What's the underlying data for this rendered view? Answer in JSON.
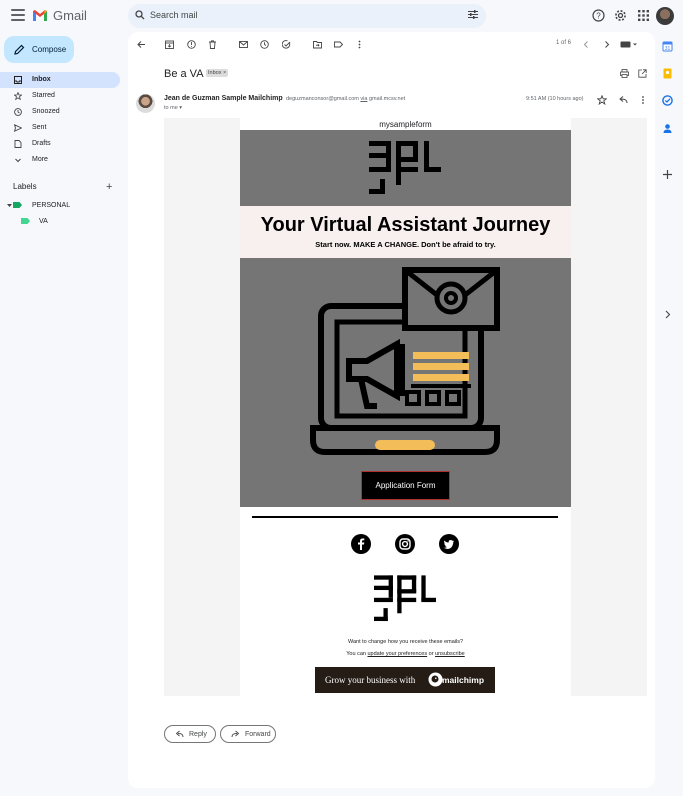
{
  "app": {
    "name": "Gmail"
  },
  "search": {
    "placeholder": "Search mail"
  },
  "compose": {
    "label": "Compose"
  },
  "nav": {
    "items": [
      {
        "label": "Inbox",
        "icon": "inbox-icon"
      },
      {
        "label": "Starred",
        "icon": "star-icon"
      },
      {
        "label": "Snoozed",
        "icon": "clock-icon"
      },
      {
        "label": "Sent",
        "icon": "send-icon"
      },
      {
        "label": "Drafts",
        "icon": "draft-icon"
      },
      {
        "label": "More",
        "icon": "chevron-down-icon"
      }
    ]
  },
  "labels": {
    "heading": "Labels",
    "items": [
      {
        "label": "PERSONAL",
        "color": "#16a765"
      },
      {
        "label": "VA",
        "color": "#43d692"
      }
    ]
  },
  "toolbar": {
    "pager": "1 of 6"
  },
  "message": {
    "subject": "Be a VA",
    "tag": "Inbox",
    "tag_close": "×",
    "sender_name": "Jean de Guzman Sample Mailchimp",
    "sender_email": "deguzmanconsor@gmail.com",
    "via_word": "via",
    "via_domain": "gmail.mcsv.net",
    "to": "to me",
    "time": "9:51 AM (10 hours ago)"
  },
  "email": {
    "top_link": "mysampleform",
    "headline": "Your Virtual Assistant Journey",
    "subline": "Start now. MAKE A CHANGE. Don't be afraid to try.",
    "button": "Application Form",
    "footer_question": "Want to change how you receive these emails?",
    "footer_prefix": "You can",
    "footer_update": "update your preferences",
    "footer_or": "or",
    "footer_unsub": "unsubscribe",
    "badge_text": "Grow your business with",
    "badge_brand": "mailchimp"
  },
  "actions": {
    "reply": "Reply",
    "forward": "Forward"
  },
  "colors": {
    "accent": "#0b57d0",
    "compose_bg": "#c2e7ff",
    "active_nav": "#d3e3fd",
    "hero_gray": "#757575",
    "illustration_yellow": "#f3bd5a"
  }
}
